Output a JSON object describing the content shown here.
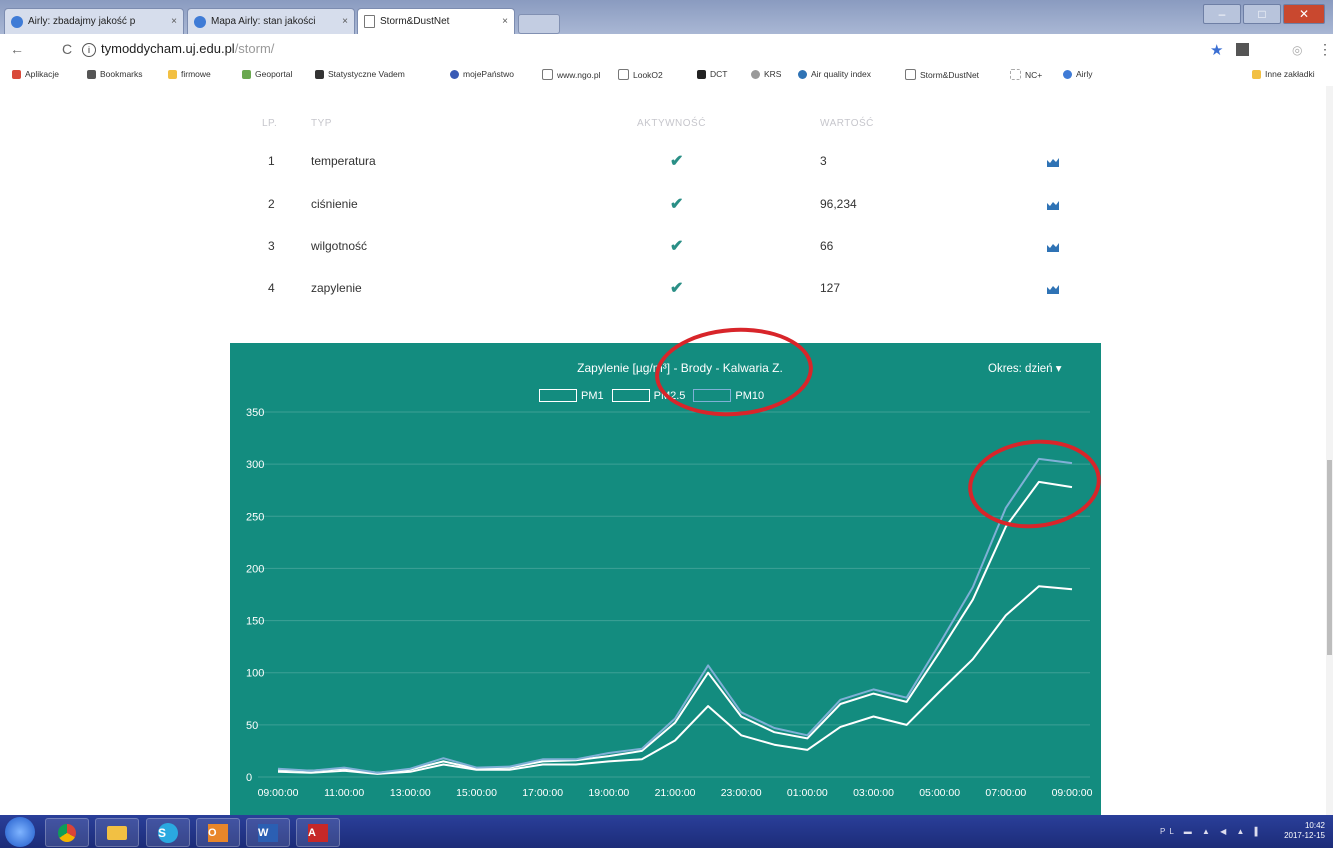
{
  "browser": {
    "tabs": [
      {
        "title": "Airly: zbadajmy jakość p",
        "icon": "airly-icon"
      },
      {
        "title": "Mapa Airly: stan jakości",
        "icon": "airly-icon"
      },
      {
        "title": "Storm&DustNet",
        "icon": "page-icon",
        "active": true
      }
    ],
    "address_host": "tymoddycham.uj.edu.pl",
    "address_path": "/storm/",
    "bookmarks": [
      {
        "label": "Aplikacje",
        "icon": "apps-icon",
        "color": "#d94a3a"
      },
      {
        "label": "Bookmarks",
        "icon": "star-icon",
        "color": "#555555"
      },
      {
        "label": "firmowe",
        "icon": "folder-icon",
        "color": "#f2c043"
      },
      {
        "label": "Geoportal",
        "icon": "geoportal-icon",
        "color": "#6aa84f"
      },
      {
        "label": "Statystyczne Vadem",
        "icon": "stats-icon",
        "color": "#333333"
      },
      {
        "label": "mojePaństwo",
        "icon": "globe-icon",
        "color": "#3a5bb5"
      },
      {
        "label": "www.ngo.pl",
        "icon": "page-icon",
        "color": "#ffffff"
      },
      {
        "label": "LookO2",
        "icon": "page-icon",
        "color": "#ffffff"
      },
      {
        "label": "DCT",
        "icon": "dct-icon",
        "color": "#222222"
      },
      {
        "label": "KRS",
        "icon": "krs-icon",
        "color": "#999999"
      },
      {
        "label": "Air quality index",
        "icon": "aqi-icon",
        "color": "#2f73b5"
      },
      {
        "label": "Storm&DustNet",
        "icon": "page-icon",
        "color": "#ffffff"
      },
      {
        "label": "NC+",
        "icon": "nc-icon",
        "color": "#dddddd"
      },
      {
        "label": "Airly",
        "icon": "airly-icon",
        "color": "#3f7bd6"
      }
    ],
    "other_bookmarks": "Inne zakładki"
  },
  "sensors": {
    "headers": {
      "lp": "LP.",
      "typ": "TYP",
      "aktywnosc": "AKTYWNOŚĆ",
      "wartosc": "WARTOŚĆ"
    },
    "rows": [
      {
        "lp": "1",
        "typ": "temperatura",
        "wartosc": "3"
      },
      {
        "lp": "2",
        "typ": "ciśnienie",
        "wartosc": "96,234"
      },
      {
        "lp": "3",
        "typ": "wilgotność",
        "wartosc": "66"
      },
      {
        "lp": "4",
        "typ": "zapylenie",
        "wartosc": "127"
      }
    ]
  },
  "chart_data": {
    "type": "line",
    "title": "Zapylenie [µg/m³] - Brody - Kalwaria Z.",
    "period_label": "Okres: dzień",
    "x": [
      "09:00:00",
      "10:00:00",
      "11:00:00",
      "12:00:00",
      "13:00:00",
      "14:00:00",
      "15:00:00",
      "16:00:00",
      "17:00:00",
      "18:00:00",
      "19:00:00",
      "20:00:00",
      "21:00:00",
      "22:00:00",
      "23:00:00",
      "00:00:00",
      "01:00:00",
      "02:00:00",
      "03:00:00",
      "04:00:00",
      "05:00:00",
      "06:00:00",
      "07:00:00",
      "08:00:00",
      "09:00:00"
    ],
    "x_tick_labels": [
      "09:00:00",
      "11:00:00",
      "13:00:00",
      "15:00:00",
      "17:00:00",
      "19:00:00",
      "21:00:00",
      "23:00:00",
      "01:00:00",
      "03:00:00",
      "05:00:00",
      "07:00:00",
      "09:00:00"
    ],
    "ylim": [
      0,
      350
    ],
    "y_ticks": [
      "0",
      "50",
      "100",
      "150",
      "200",
      "250",
      "300",
      "350"
    ],
    "grid": true,
    "legend_position": "top-center",
    "series": [
      {
        "name": "PM1",
        "color": "#ffffff",
        "values": [
          5,
          4,
          6,
          3,
          5,
          12,
          7,
          7,
          12,
          12,
          15,
          17,
          35,
          68,
          40,
          31,
          26,
          48,
          58,
          50,
          82,
          113,
          155,
          183,
          180
        ]
      },
      {
        "name": "PM2.5",
        "color": "#ffffff",
        "values": [
          7,
          6,
          8,
          4,
          7,
          15,
          8,
          9,
          15,
          16,
          20,
          25,
          52,
          100,
          58,
          43,
          37,
          70,
          80,
          72,
          120,
          170,
          240,
          283,
          278
        ]
      },
      {
        "name": "PM10",
        "color": "#7fb0d6",
        "values": [
          8,
          6,
          9,
          4,
          8,
          18,
          9,
          10,
          17,
          17,
          23,
          27,
          56,
          107,
          62,
          47,
          40,
          74,
          84,
          76,
          128,
          182,
          258,
          305,
          301
        ]
      }
    ]
  },
  "taskbar": {
    "apps": [
      "start-orb",
      "chrome",
      "explorer",
      "skype",
      "outlook",
      "word",
      "acrobat"
    ],
    "tray_lang": "PL",
    "time": "10:42",
    "date": "2017-12-15"
  },
  "colors": {
    "panel": "#138c7f",
    "accent": "#2a8f86",
    "annotation": "#d8252a"
  }
}
